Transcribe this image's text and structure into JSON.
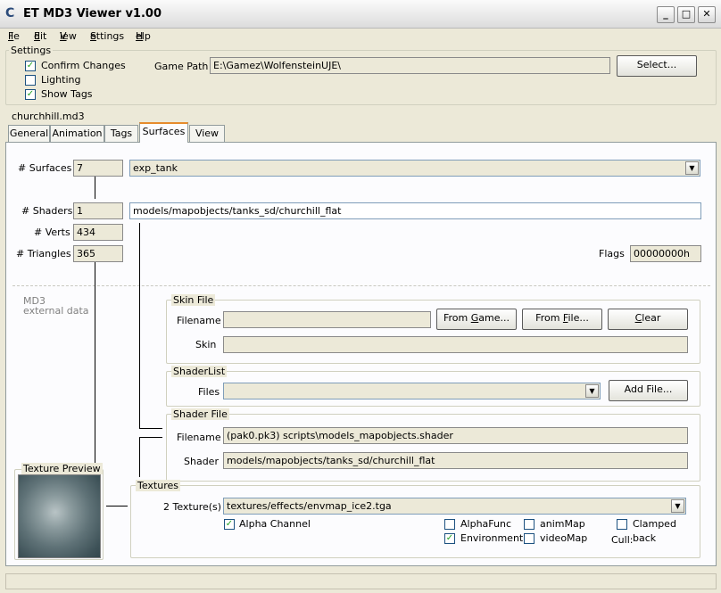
{
  "window": {
    "title": "ET MD3 Viewer v1.00",
    "icon": "C"
  },
  "menu": [
    {
      "label": "File",
      "key": "F",
      "rest": "ile"
    },
    {
      "label": "Edit",
      "key": "E",
      "rest": "dit"
    },
    {
      "label": "View",
      "key": "V",
      "rest": "iew"
    },
    {
      "label": "Settings",
      "key": "S",
      "rest": "ettings"
    },
    {
      "label": "Help",
      "key": "H",
      "rest": "elp"
    }
  ],
  "settings": {
    "group_label": "Settings",
    "confirm_changes": {
      "label": "Confirm Changes",
      "checked": true
    },
    "lighting": {
      "label": "Lighting",
      "checked": false
    },
    "show_tags": {
      "label": "Show Tags",
      "checked": true
    },
    "game_path_label": "Game Path",
    "game_path_value": "E:\\Gamez\\WolfensteinUJE\\",
    "select_button": "Select..."
  },
  "file": {
    "name": "churchhill.md3"
  },
  "tabs": [
    {
      "label": "General",
      "active": false
    },
    {
      "label": "Animation",
      "active": false
    },
    {
      "label": "Tags",
      "active": false
    },
    {
      "label": "Surfaces",
      "active": true
    },
    {
      "label": "View",
      "active": false
    }
  ],
  "surfaces": {
    "surfaces_label": "# Surfaces",
    "surfaces_count": "7",
    "surface_name": "exp_tank",
    "shaders_label": "# Shaders",
    "shaders_count": "1",
    "shader_path": "models/mapobjects/tanks_sd/churchill_flat",
    "verts_label": "# Verts",
    "verts_count": "434",
    "triangles_label": "# Triangles",
    "triangles_count": "365",
    "flags_label": "Flags",
    "flags_value": "00000000h",
    "md3_ext_line1": "MD3",
    "md3_ext_line2": "external data"
  },
  "skin_file": {
    "group_label": "Skin File",
    "filename_label": "Filename",
    "filename_value": "",
    "skin_label": "Skin",
    "skin_value": "",
    "from_game_key": "G",
    "from_game_pre": "From ",
    "from_game_post": "ame...",
    "from_file_pre": "From ",
    "from_file_key": "F",
    "from_file_post": "ile...",
    "clear_key": "C",
    "clear_post": "lear"
  },
  "shader_list": {
    "group_label": "ShaderList",
    "files_label": "Files",
    "files_value": "",
    "add_file_button": "Add File..."
  },
  "shader_file": {
    "group_label": "Shader File",
    "filename_label": "Filename",
    "filename_value": "(pak0.pk3) scripts\\models_mapobjects.shader",
    "shader_label": "Shader",
    "shader_value": "models/mapobjects/tanks_sd/churchill_flat"
  },
  "texture_preview": {
    "label": "Texture Preview"
  },
  "textures": {
    "group_label": "Textures",
    "texture_count_label": "2 Texture(s)",
    "texture_value": "textures/effects/envmap_ice2.tga",
    "alpha_channel": {
      "label": "Alpha Channel",
      "checked": true
    },
    "alpha_func": {
      "label": "AlphaFunc",
      "checked": false
    },
    "anim_map": {
      "label": "animMap",
      "checked": false
    },
    "clamped": {
      "label": "Clamped",
      "checked": false
    },
    "environment": {
      "label": "Environment",
      "checked": true
    },
    "video_map": {
      "label": "videoMap",
      "checked": false
    },
    "cull_label": "Cull:",
    "cull_value": "back"
  },
  "colors": {
    "tab_active_accent": "#e68b2c",
    "titlebar": "#dcdcdc"
  },
  "icons": [
    "minimize-icon",
    "maximize-icon",
    "close-icon",
    "dropdown-arrow-icon",
    "checkmark-icon"
  ]
}
